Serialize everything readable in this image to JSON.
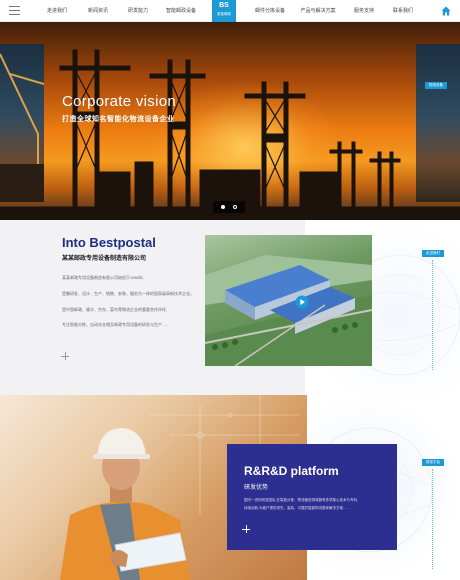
{
  "nav": {
    "items": [
      {
        "label": "走进我们"
      },
      {
        "label": "新闻资讯"
      },
      {
        "label": "研发能力"
      },
      {
        "label": "智能邮政设备"
      },
      {
        "label": "邮件分拣设备"
      },
      {
        "label": "产品与解决方案"
      },
      {
        "label": "服务支持"
      },
      {
        "label": "联系我们"
      }
    ],
    "logo_mark": "BS",
    "logo_text": "某某邮政"
  },
  "hero": {
    "title": "Corporate vision",
    "subtitle": "打造全球知名智能化物流设备企业",
    "right_tag": "物流设备"
  },
  "about": {
    "title": "Into Bestpostal",
    "subtitle": "某某邮政专用设备制造有限公司",
    "paragraphs": [
      "某某邮政专用设备制造有限公司始创于1958年,",
      "是集研发、设计、生产、销售、安装、服务为一体的国家级高新技术企业。",
      "是中国邮政、顺丰、京东、菜鸟等物流企业的重要合作伙伴,",
      "专注智能分拣、自动化仓储及邮政专用设备的研发与生产……"
    ],
    "tag": "走进我们"
  },
  "rd": {
    "title": "R&R&D platform",
    "subtitle": "研发优势",
    "paragraphs": [
      "国内一流的研发团队,在智能分拣、物流输送领域拥有多项核心技术与专利,",
      "持续创新,为客户提供领先、高效、可靠的智能物流整体解决方案……"
    ],
    "tag": "研发平台"
  },
  "colors": {
    "brand_blue": "#1d9ad6",
    "title_navy": "#1f2e80",
    "card_indigo": "#2c2f8f"
  }
}
